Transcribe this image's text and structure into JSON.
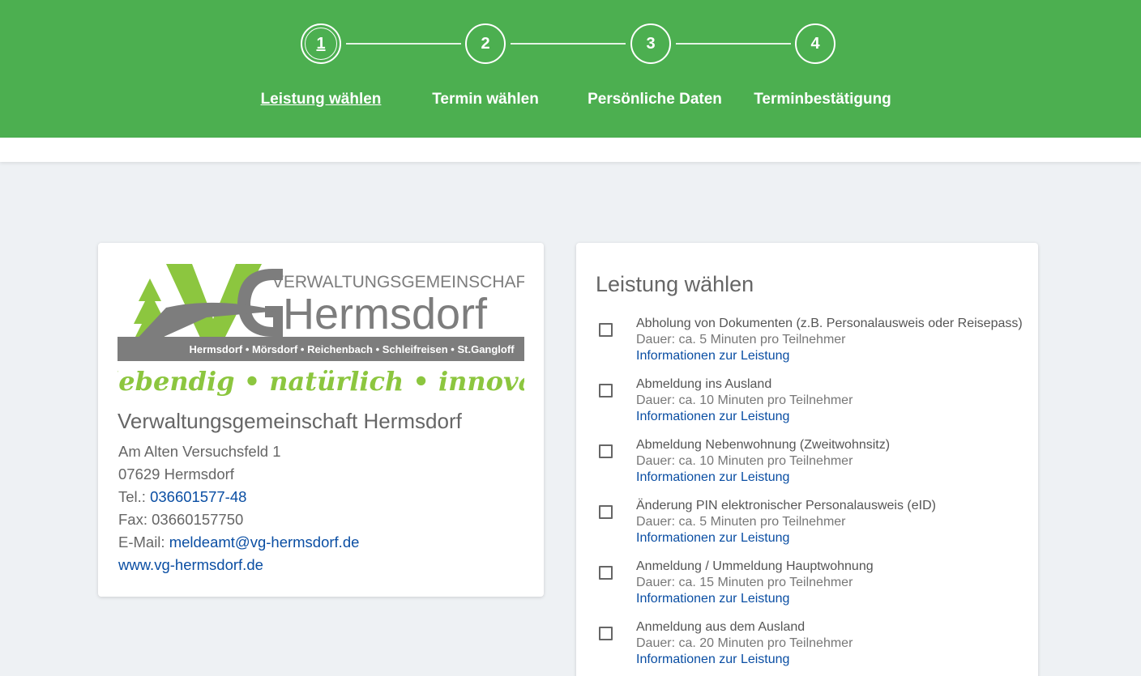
{
  "stepper": {
    "steps": [
      {
        "number": "1",
        "label": "Leistung wählen"
      },
      {
        "number": "2",
        "label": "Termin wählen"
      },
      {
        "number": "3",
        "label": "Persönliche Daten"
      },
      {
        "number": "4",
        "label": "Terminbestätigung"
      }
    ],
    "active_step": "1"
  },
  "colors": {
    "header_green": "#4caf50",
    "logo_green": "#8cc63f",
    "logo_gray": "#7d7d7d",
    "link_blue": "#0a4ea3",
    "page_background": "#eef1f4"
  },
  "office": {
    "logo": {
      "heading": "VERWALTUNGSGEMEINSCHAFT",
      "name": "Hermsdorf",
      "towns": "Hermsdorf • Mörsdorf • Reichenbach • Schleifreisen • St.Gangloff",
      "slogan": "lebendig • natürlich • innovativ"
    },
    "name": "Verwaltungsgemeinschaft Hermsdorf",
    "street": "Am Alten Versuchsfeld 1",
    "city": "07629 Hermsdorf",
    "tel_label": "Tel.: ",
    "tel": "036601577-48",
    "fax": "Fax: 03660157750",
    "email_label": "E-Mail: ",
    "email": "meldeamt@vg-hermsdorf.de",
    "website": "www.vg-hermsdorf.de"
  },
  "services": {
    "title": "Leistung wählen",
    "info_link": "Informationen zur Leistung",
    "items": [
      {
        "name": "Abholung von Dokumenten (z.B. Personalausweis oder Reisepass)",
        "duration": "Dauer: ca. 5 Minuten pro Teilnehmer",
        "checked": false
      },
      {
        "name": "Abmeldung ins Ausland",
        "duration": "Dauer: ca. 10 Minuten pro Teilnehmer",
        "checked": false
      },
      {
        "name": "Abmeldung Nebenwohnung (Zweitwohnsitz)",
        "duration": "Dauer: ca. 10 Minuten pro Teilnehmer",
        "checked": false
      },
      {
        "name": "Änderung PIN elektronischer Personalausweis (eID)",
        "duration": "Dauer: ca. 5 Minuten pro Teilnehmer",
        "checked": false
      },
      {
        "name": "Anmeldung / Ummeldung Hauptwohnung",
        "duration": "Dauer: ca. 15 Minuten pro Teilnehmer",
        "checked": false
      },
      {
        "name": "Anmeldung aus dem Ausland",
        "duration": "Dauer: ca. 20 Minuten pro Teilnehmer",
        "checked": false
      }
    ]
  }
}
